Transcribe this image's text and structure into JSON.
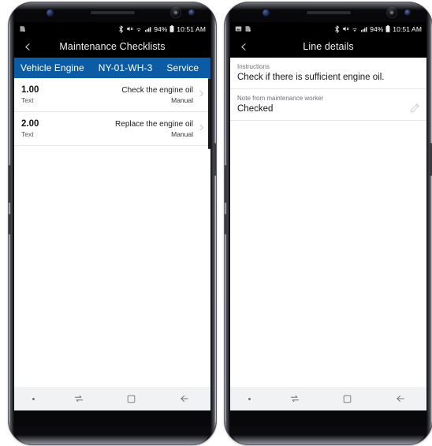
{
  "phones": [
    {
      "id": "checklists",
      "status_bar": {
        "left_icons": [
          "screenshot-icon"
        ],
        "bluetooth": "bluetooth-icon",
        "mute": "mute-icon",
        "wifi": "wifi-icon",
        "signal": "signal-icon",
        "battery_percent": "94%",
        "battery": "battery-icon",
        "clock": "10:51 AM"
      },
      "title_bar": {
        "back": "back-chevron-icon",
        "title": "Maintenance Checklists"
      },
      "context_header": {
        "asset": "Vehicle Engine",
        "vehicle": "NY-01-WH-3",
        "type": "Service",
        "color": "#0c5ba5"
      },
      "rows": [
        {
          "number": "1.00",
          "subtitle": "Text",
          "title": "Check the engine oil",
          "meta": "Manual",
          "chevron": "chevron-right-icon"
        },
        {
          "number": "2.00",
          "subtitle": "Text",
          "title": "Replace the engine oil",
          "meta": "Manual",
          "chevron": "chevron-right-icon"
        }
      ],
      "nav_bar": {
        "dot": "nav-dot-icon",
        "recents": "recents-icon",
        "home": "home-square-icon",
        "back": "back-arrow-icon"
      }
    },
    {
      "id": "line-details",
      "status_bar": {
        "left_icons": [
          "image-icon",
          "screenshot-icon"
        ],
        "bluetooth": "bluetooth-icon",
        "mute": "mute-icon",
        "wifi": "wifi-icon",
        "signal": "signal-icon",
        "battery_percent": "94%",
        "battery": "battery-icon",
        "clock": "10:51 AM"
      },
      "title_bar": {
        "back": "back-chevron-icon",
        "title": "Line details"
      },
      "fields": [
        {
          "label": "Instructions",
          "value": "Check if there is sufficient engine oil.",
          "edit": null
        },
        {
          "label": "Note from maintenance worker",
          "value": "Checked",
          "edit": "edit-pencil-icon"
        }
      ],
      "nav_bar": {
        "dot": "nav-dot-icon",
        "recents": "recents-icon",
        "home": "home-square-icon",
        "back": "back-arrow-icon"
      }
    }
  ]
}
